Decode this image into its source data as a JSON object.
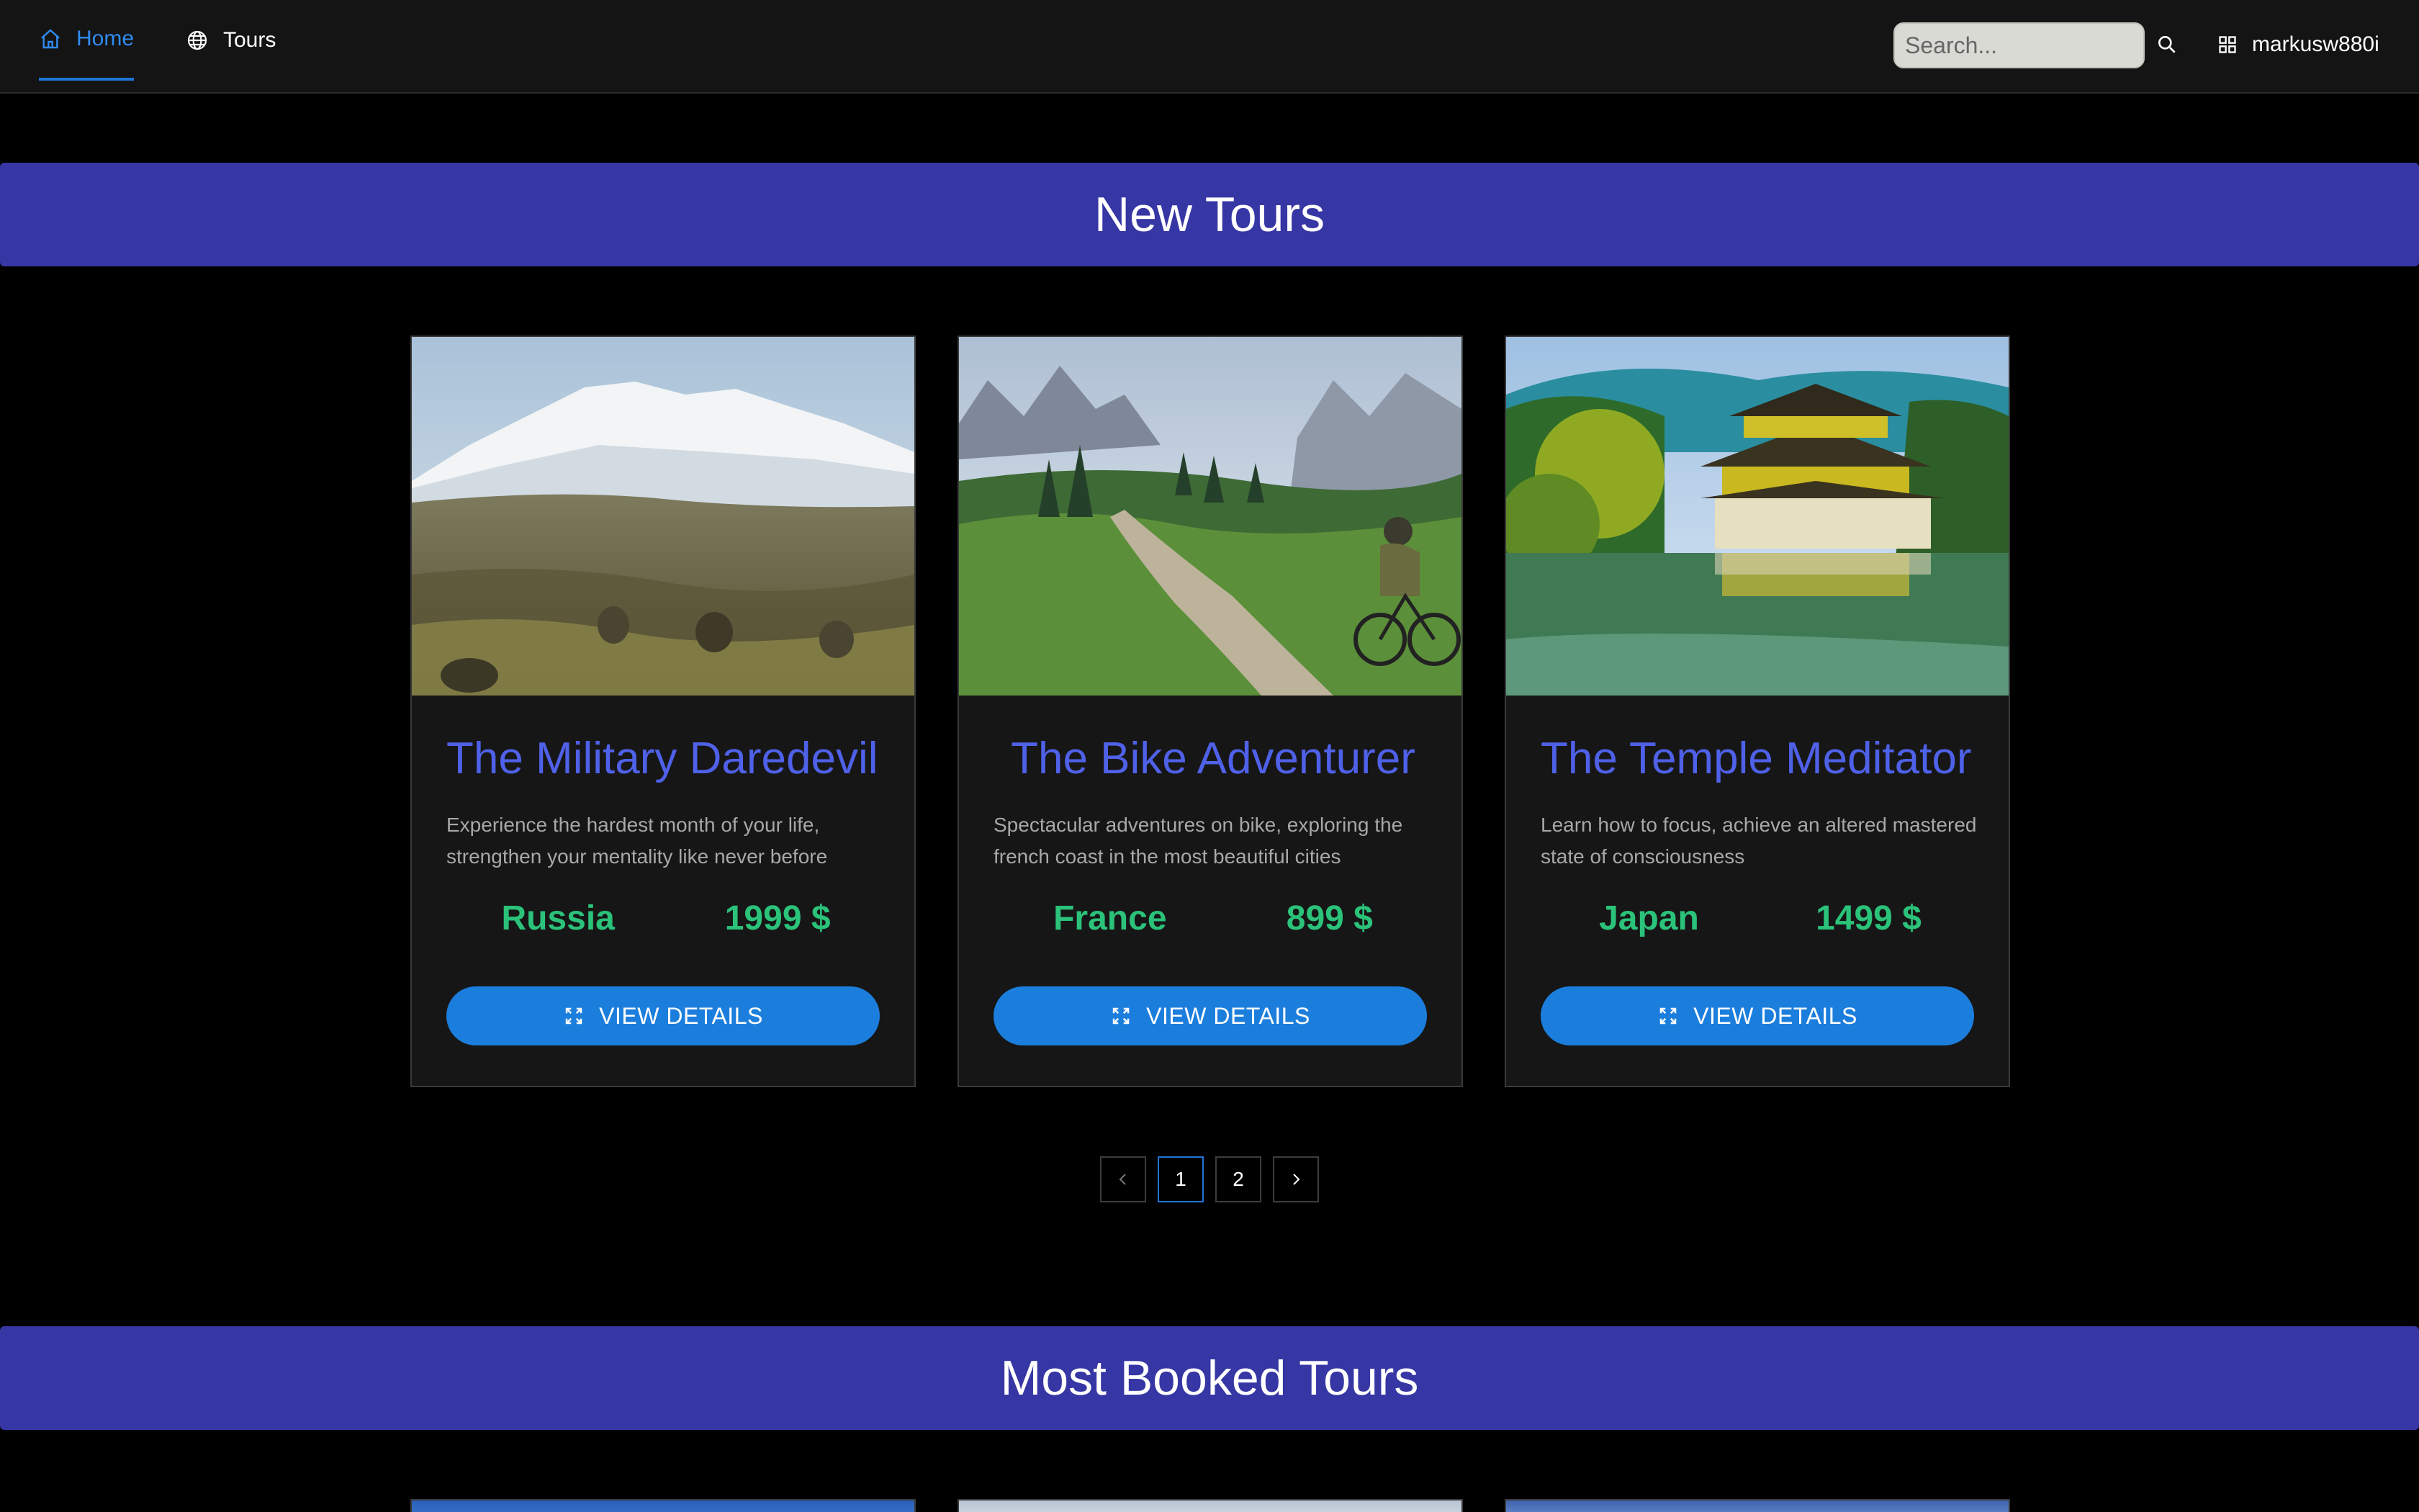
{
  "nav": {
    "home_label": "Home",
    "tours_label": "Tours",
    "search_placeholder": "Search...",
    "username": "markusw880i",
    "accent_color": "#2f8cf0"
  },
  "sections": {
    "new_tours_title": "New Tours",
    "most_booked_title": "Most Booked Tours",
    "banner_color": "#3636a4"
  },
  "tours": [
    {
      "title": "The Military Daredevil",
      "description": "Experience the hardest month of your life, strengthen your mentality like never before",
      "country": "Russia",
      "price": "1999 $",
      "button_label": "VIEW DETAILS",
      "image": "snowy-mountain-soldiers-photo"
    },
    {
      "title": "The Bike Adventurer",
      "description": "Spectacular adventures on bike, exploring the french coast in the most beautiful cities",
      "country": "France",
      "price": "899 $",
      "button_label": "VIEW DETAILS",
      "image": "mountain-bike-trail-photo"
    },
    {
      "title": "The Temple Meditator",
      "description": "Learn how to focus, achieve an altered mastered state of consciousness",
      "country": "Japan",
      "price": "1499 $",
      "button_label": "VIEW DETAILS",
      "image": "golden-pavilion-temple-photo"
    }
  ],
  "pagination": {
    "prev_icon": "chevron-left-icon",
    "pages": [
      "1",
      "2"
    ],
    "current": "1",
    "next_icon": "chevron-right-icon"
  },
  "colors": {
    "title": "#4f61e8",
    "meta": "#2bc27a",
    "button": "#1c7edc",
    "card_bg": "#161616"
  }
}
